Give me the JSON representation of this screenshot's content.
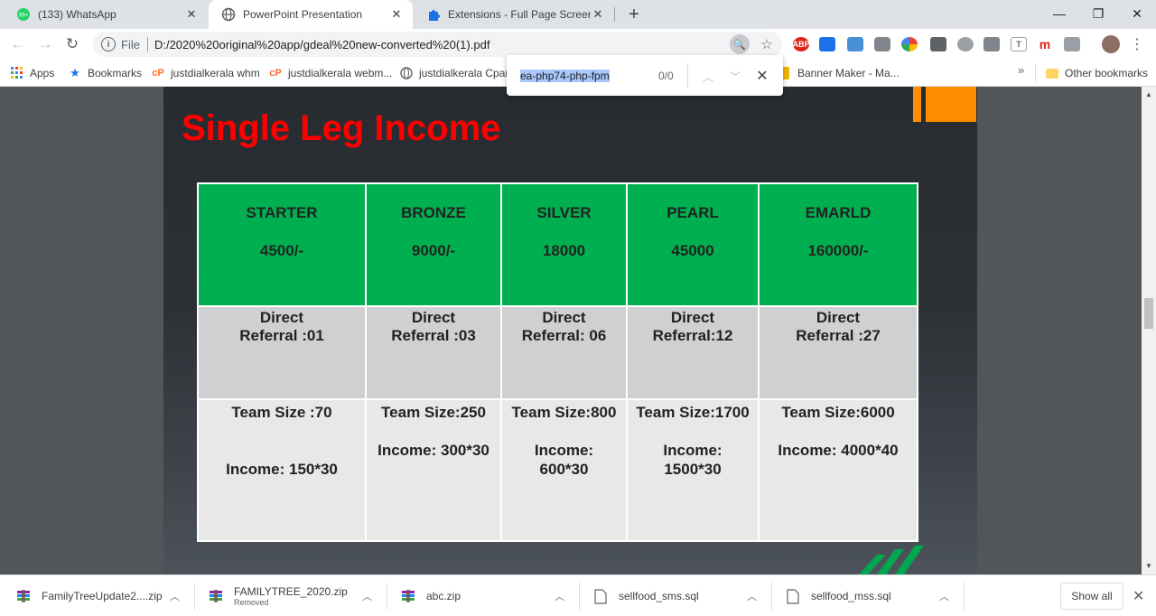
{
  "browser": {
    "tabs": [
      {
        "title": "(133) WhatsApp",
        "badge": "99+"
      },
      {
        "title": "PowerPoint Presentation"
      },
      {
        "title": "Extensions - Full Page Screen Cap"
      }
    ],
    "address": {
      "scheme": "File",
      "url": "D:/2020%20original%20app/gdeal%20new-converted%20(1).pdf"
    },
    "bookmarks": [
      "Apps",
      "Bookmarks",
      "justdialkerala whm",
      "justdialkerala webm...",
      "justdialkerala Cpane",
      "Banner Maker - Ma...",
      "Other bookmarks"
    ],
    "bookmarks_overflow": "»",
    "find": {
      "query": "ea-php74-php-fpm",
      "count": "0/0"
    },
    "extensions": [
      "ABP",
      "m",
      "T"
    ]
  },
  "slide": {
    "title": "Single Leg Income",
    "colors": {
      "title": "#ff0000",
      "header": "#00b050",
      "accent": "#ff8c00"
    },
    "plans": [
      {
        "name": "STARTER",
        "price": "4500/-",
        "referral": "Direct\nReferral :01",
        "team": "Team Size :70",
        "income": "\n\nIncome: 150*30"
      },
      {
        "name": "BRONZE",
        "price": "9000/-",
        "referral": "Direct\nReferral :03",
        "team": "Team Size:250",
        "income": "\nIncome: 300*30"
      },
      {
        "name": "SILVER",
        "price": "18000",
        "referral": "Direct\nReferral: 06",
        "team": "Team Size:800",
        "income": "\nIncome:\n600*30"
      },
      {
        "name": "PEARL",
        "price": "45000",
        "referral": "Direct\nReferral:12",
        "team": "Team Size:1700",
        "income": "\nIncome:\n1500*30"
      },
      {
        "name": "EMARLD",
        "price": "160000/-",
        "referral": "Direct\nReferral :27",
        "team": "Team Size:6000",
        "income": "\nIncome: 4000*40"
      }
    ]
  },
  "downloads": {
    "items": [
      {
        "name": "FamilyTreeUpdate2....zip",
        "status": ""
      },
      {
        "name": "FAMILYTREE_2020.zip",
        "status": "Removed"
      },
      {
        "name": "abc.zip",
        "status": ""
      },
      {
        "name": "sellfood_sms.sql",
        "status": ""
      },
      {
        "name": "sellfood_mss.sql",
        "status": ""
      }
    ],
    "show_all": "Show all"
  }
}
